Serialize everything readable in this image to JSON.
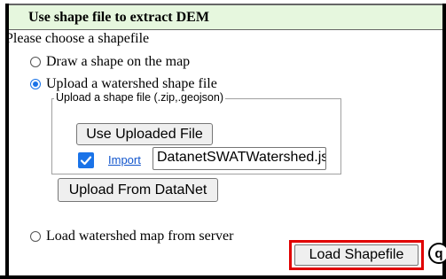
{
  "header": {
    "title": "Use shape file to extract DEM"
  },
  "prompt": "Please choose a shapefile",
  "options": {
    "draw": "Draw a shape on the map",
    "upload": "Upload a watershed shape file",
    "server": "Load watershed map from server"
  },
  "upload_group": {
    "legend": "Upload a shape file (.zip,.geojson)",
    "use_uploaded_label": "Use Uploaded File",
    "import_label": "Import",
    "file_value": "DatanetSWATWatershed.json",
    "upload_datanet_label": "Upload From DataNet"
  },
  "load_button_label": "Load Shapefile",
  "badge_label": "q",
  "colors": {
    "header_bg": "#e6f7de",
    "accent": "#1a73e8",
    "highlight_border": "#e00000"
  }
}
